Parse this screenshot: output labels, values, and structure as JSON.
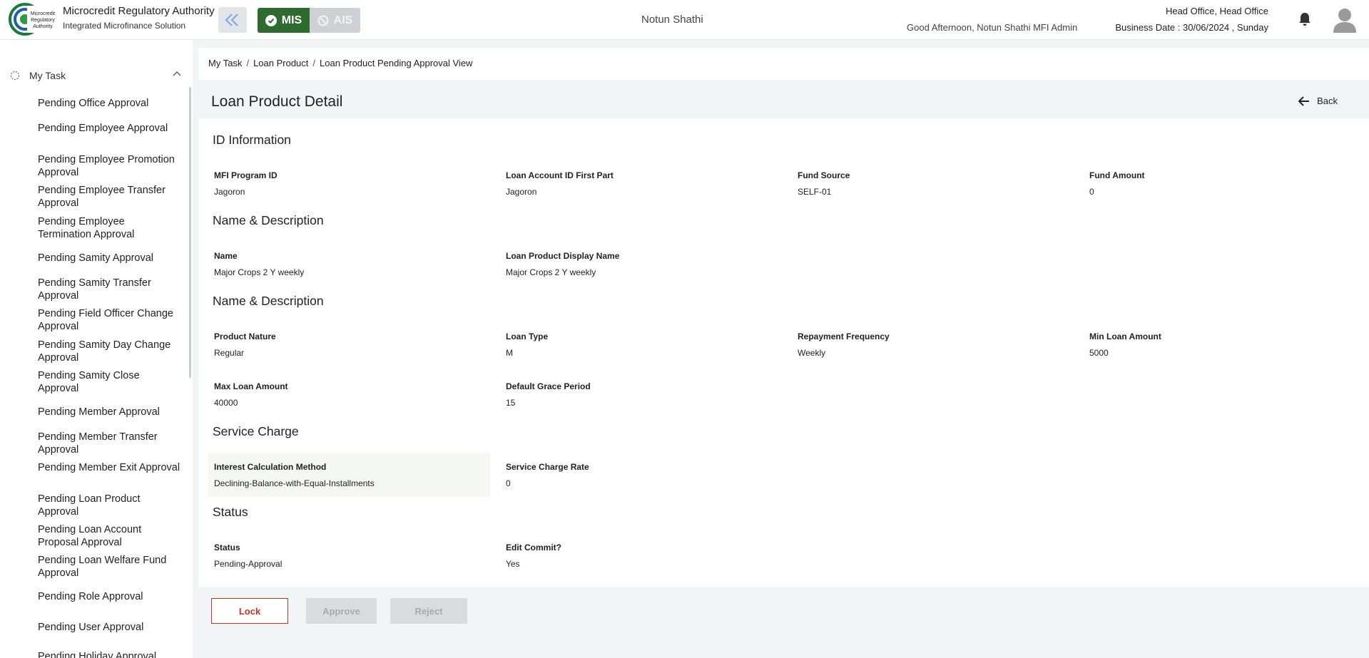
{
  "header": {
    "org_name": "Microcredit Regulatory Authority",
    "org_sub": "Integrated Microfinance Solution",
    "logo_text": "Microcredit Regulatory Authority",
    "mis_label": "MIS",
    "ais_label": "AIS",
    "center_title": "Notun Shathi",
    "greeting": "Good Afternoon, Notun Shathi MFI Admin",
    "office": "Head Office, Head Office",
    "business_date": "Business Date : 30/06/2024 , Sunday"
  },
  "sidebar": {
    "cut_label": "",
    "group_label": "My Task",
    "items": [
      "Pending Office Approval",
      "Pending Employee Approval",
      "Pending Employee Promotion Approval",
      "Pending Employee Transfer Approval",
      "Pending Employee Termination Approval",
      "Pending Samity Approval",
      "Pending Samity Transfer Approval",
      "Pending Field Officer Change Approval",
      "Pending Samity Day Change Approval",
      "Pending Samity Close Approval",
      "Pending Member Approval",
      "Pending Member Transfer Approval",
      "Pending Member Exit Approval",
      "Pending Loan Product Approval",
      "Pending Loan Account Proposal Approval",
      "Pending Loan Welfare Fund Approval",
      "Pending Role Approval",
      "Pending User Approval",
      "Pending Holiday Approval"
    ]
  },
  "breadcrumb": [
    "My Task",
    "Loan Product",
    "Loan Product Pending Approval View"
  ],
  "panel": {
    "title": "Loan Product Detail",
    "back_label": "Back"
  },
  "sections": {
    "id_info": {
      "title": "ID Information",
      "fields": [
        {
          "label": "MFI Program ID",
          "value": "Jagoron"
        },
        {
          "label": "Loan Account ID First Part",
          "value": "Jagoron"
        },
        {
          "label": "Fund Source",
          "value": "SELF-01"
        },
        {
          "label": "Fund Amount",
          "value": "0"
        }
      ]
    },
    "name_desc": {
      "title": "Name & Description",
      "fields": [
        {
          "label": "Name",
          "value": "Major Crops 2 Y weekly"
        },
        {
          "label": "Loan Product Display Name",
          "value": "Major Crops 2 Y weekly"
        }
      ]
    },
    "name_desc_2": {
      "title": "Name & Description",
      "fields": [
        {
          "label": "Product Nature",
          "value": "Regular"
        },
        {
          "label": "Loan Type",
          "value": "M"
        },
        {
          "label": "Repayment Frequency",
          "value": "Weekly"
        },
        {
          "label": "Min Loan Amount",
          "value": "5000"
        },
        {
          "label": "Max Loan Amount",
          "value": "40000"
        },
        {
          "label": "Default Grace Period",
          "value": "15"
        }
      ]
    },
    "service_charge": {
      "title": "Service Charge",
      "fields": [
        {
          "label": "Interest Calculation Method",
          "value": "Declining-Balance-with-Equal-Installments"
        },
        {
          "label": "Service Charge Rate",
          "value": "0"
        }
      ]
    },
    "status": {
      "title": "Status",
      "fields": [
        {
          "label": "Status",
          "value": "Pending-Approval"
        },
        {
          "label": "Edit Commit?",
          "value": "Yes"
        }
      ]
    }
  },
  "actions": {
    "lock_label": "Lock",
    "approve_label": "Approve",
    "reject_label": "Reject"
  },
  "colors": {
    "mis_active": "#2e6b2f",
    "lock_border": "#c9302c",
    "disabled_btn": "#d9dbdd"
  },
  "icons": [
    "logo-icon",
    "double-chevron-left-icon",
    "check-circle-icon",
    "ban-icon",
    "bell-icon",
    "user-avatar-icon",
    "spinner-icon",
    "chevron-up-icon",
    "arrow-left-icon"
  ]
}
